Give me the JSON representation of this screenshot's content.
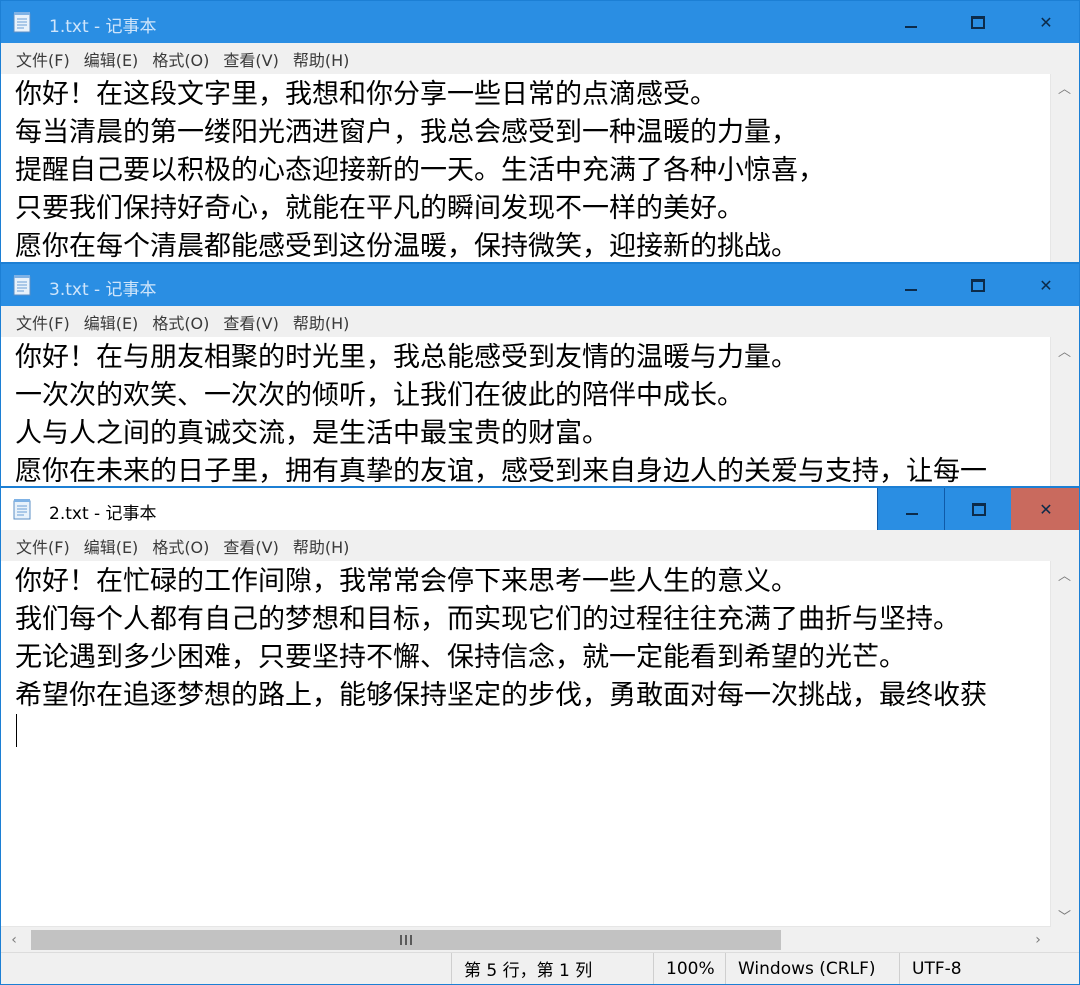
{
  "menu": [
    "文件(F)",
    "编辑(E)",
    "格式(O)",
    "查看(V)",
    "帮助(H)"
  ],
  "windows": {
    "w1": {
      "title": "1.txt - 记事本",
      "lines": [
        "你好！在这段文字里，我想和你分享一些日常的点滴感受。",
        "每当清晨的第一缕阳光洒进窗户，我总会感受到一种温暖的力量，",
        "提醒自己要以积极的心态迎接新的一天。生活中充满了各种小惊喜，",
        "只要我们保持好奇心，就能在平凡的瞬间发现不一样的美好。",
        "愿你在每个清晨都能感受到这份温暖，保持微笑，迎接新的挑战。"
      ]
    },
    "w3": {
      "title": "3.txt - 记事本",
      "lines": [
        "你好！在与朋友相聚的时光里，我总能感受到友情的温暖与力量。",
        "一次次的欢笑、一次次的倾听，让我们在彼此的陪伴中成长。",
        "人与人之间的真诚交流，是生活中最宝贵的财富。",
        "愿你在未来的日子里，拥有真挚的友谊，感受到来自身边人的关爱与支持，让每一"
      ]
    },
    "w2": {
      "title": "2.txt - 记事本",
      "lines": [
        "你好！在忙碌的工作间隙，我常常会停下来思考一些人生的意义。",
        "我们每个人都有自己的梦想和目标，而实现它们的过程往往充满了曲折与坚持。",
        "无论遇到多少困难，只要坚持不懈、保持信念，就一定能看到希望的光芒。",
        "希望你在追逐梦想的路上，能够保持坚定的步伐，勇敢面对每一次挑战，最终收获"
      ],
      "status": {
        "position": "第 5 行，第 1 列",
        "zoom": "100%",
        "line_ending": "Windows (CRLF)",
        "encoding": "UTF-8"
      }
    }
  },
  "icons": {
    "app": "notepad-icon",
    "minimize": "minimize-icon",
    "maximize": "maximize-icon",
    "close": "close-icon"
  },
  "colors": {
    "titlebar_active": "#2a8ee3",
    "close_hover": "#c96a5e",
    "menubar_bg": "#f0f0f0"
  }
}
